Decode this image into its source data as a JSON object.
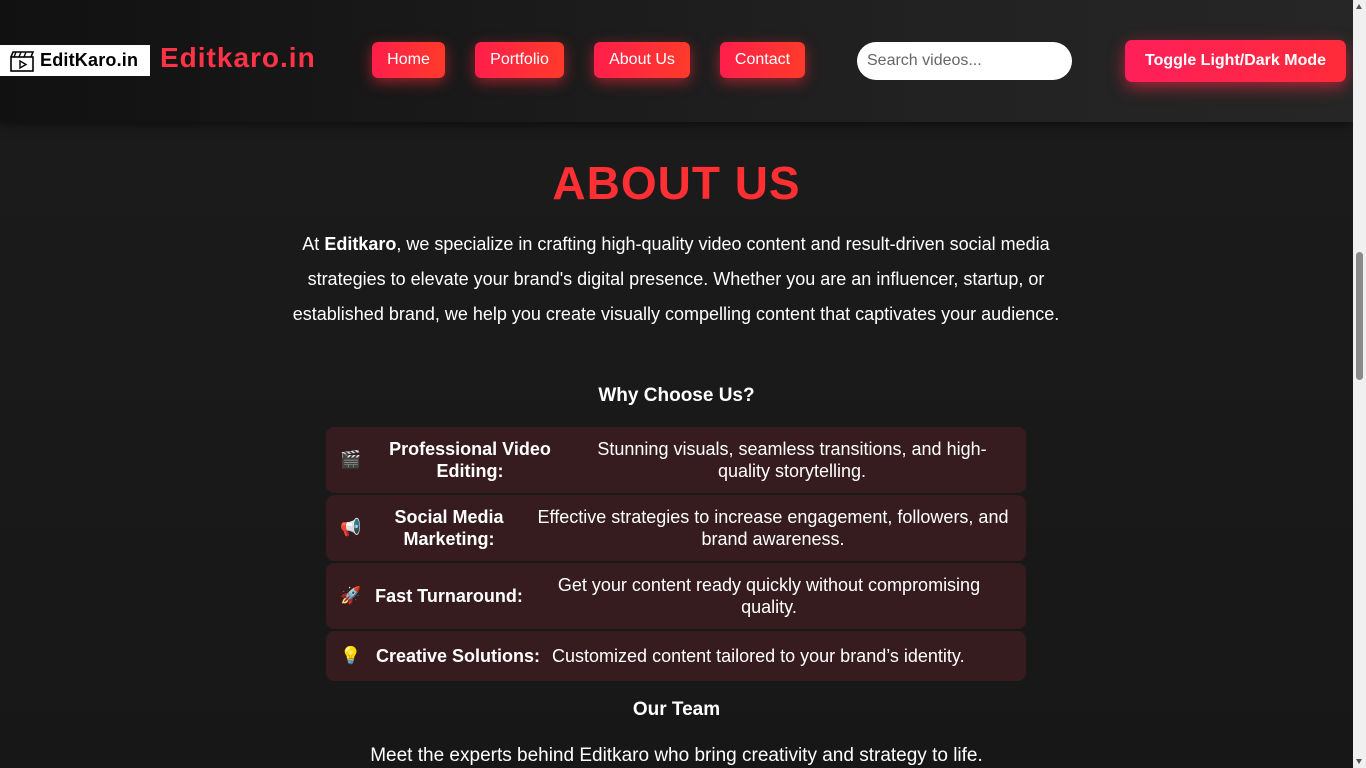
{
  "header": {
    "logo_text": "EditKaro.in",
    "brand_title": "Editkaro.in",
    "nav": [
      {
        "label": "Home"
      },
      {
        "label": "Portfolio"
      },
      {
        "label": "About Us"
      },
      {
        "label": "Contact"
      }
    ],
    "search": {
      "placeholder": "Search videos..."
    },
    "toggle_label": "Toggle Light/Dark Mode"
  },
  "about": {
    "title": "ABOUT US",
    "intro_prefix": "At ",
    "intro_brand": "Editkaro",
    "intro_rest": ", we specialize in crafting high-quality video content and result-driven social media strategies to elevate your brand's digital presence. Whether you are an influencer, startup, or established brand, we help you create visually compelling content that captivates your audience.",
    "why_heading": "Why Choose Us?",
    "features": [
      {
        "icon": "clapperboard-icon",
        "glyph": "🎬",
        "label": "Professional Video Editing:",
        "desc": "Stunning visuals, seamless transitions, and high-quality storytelling."
      },
      {
        "icon": "megaphone-icon",
        "glyph": "📢",
        "label": "Social Media Marketing:",
        "desc": "Effective strategies to increase engagement, followers, and brand awareness."
      },
      {
        "icon": "rocket-icon",
        "glyph": "🚀",
        "label": "Fast Turnaround:",
        "desc": "Get your content ready quickly without compromising quality."
      },
      {
        "icon": "lightbulb-icon",
        "glyph": "💡",
        "label": "Creative Solutions:",
        "desc": "Customized content tailored to your brand’s identity."
      }
    ],
    "team_heading": "Our Team",
    "team_text": "Meet the experts behind Editkaro who bring creativity and strategy to life."
  },
  "colors": {
    "accent": "#ff2f33",
    "button_gradient_start": "#ff1f4b",
    "button_gradient_end": "#ff3a2a",
    "feature_bg": "#361c1f",
    "page_bg": "#181818"
  }
}
